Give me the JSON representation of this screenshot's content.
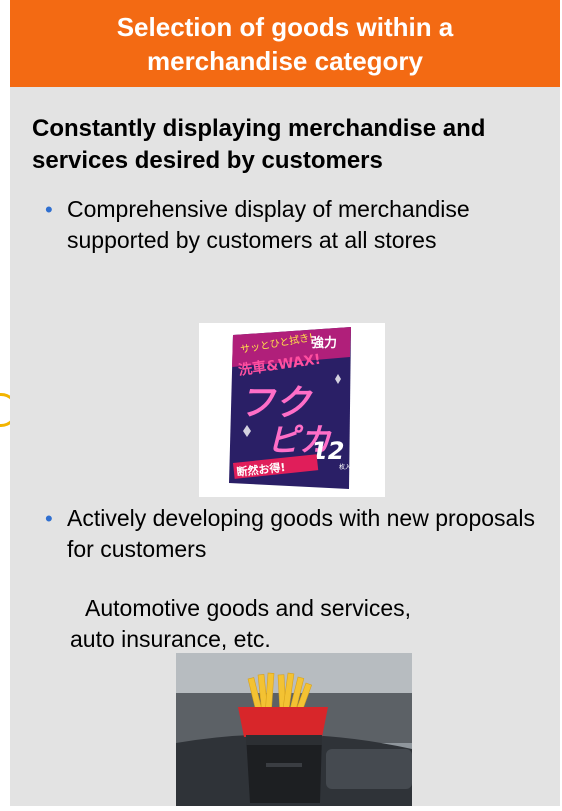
{
  "header": {
    "title": "Selection of goods within a merchandise category"
  },
  "section": {
    "heading": "Constantly displaying merchandise and services desired by customers"
  },
  "bullets": [
    {
      "text": "Comprehensive display of merchandise supported by customers at all stores"
    },
    {
      "text": "Actively developing goods with new proposals for customers"
    }
  ],
  "note": {
    "line1": "Automotive goods and services,",
    "line2": "auto insurance, etc."
  },
  "product_package": {
    "top_text": "サッとひと拭き!",
    "strength": "強力",
    "subtitle": "洗車&WAX!",
    "big_line1": "フク",
    "big_line2": "ピカ",
    "count": "12",
    "count_unit": "枚入",
    "banner": "断然お得!"
  },
  "colors": {
    "header_bg": "#f36a13",
    "panel_bg": "#e3e3e3",
    "bullet": "#2f6fd0",
    "edge_circle": "#f2b400"
  }
}
